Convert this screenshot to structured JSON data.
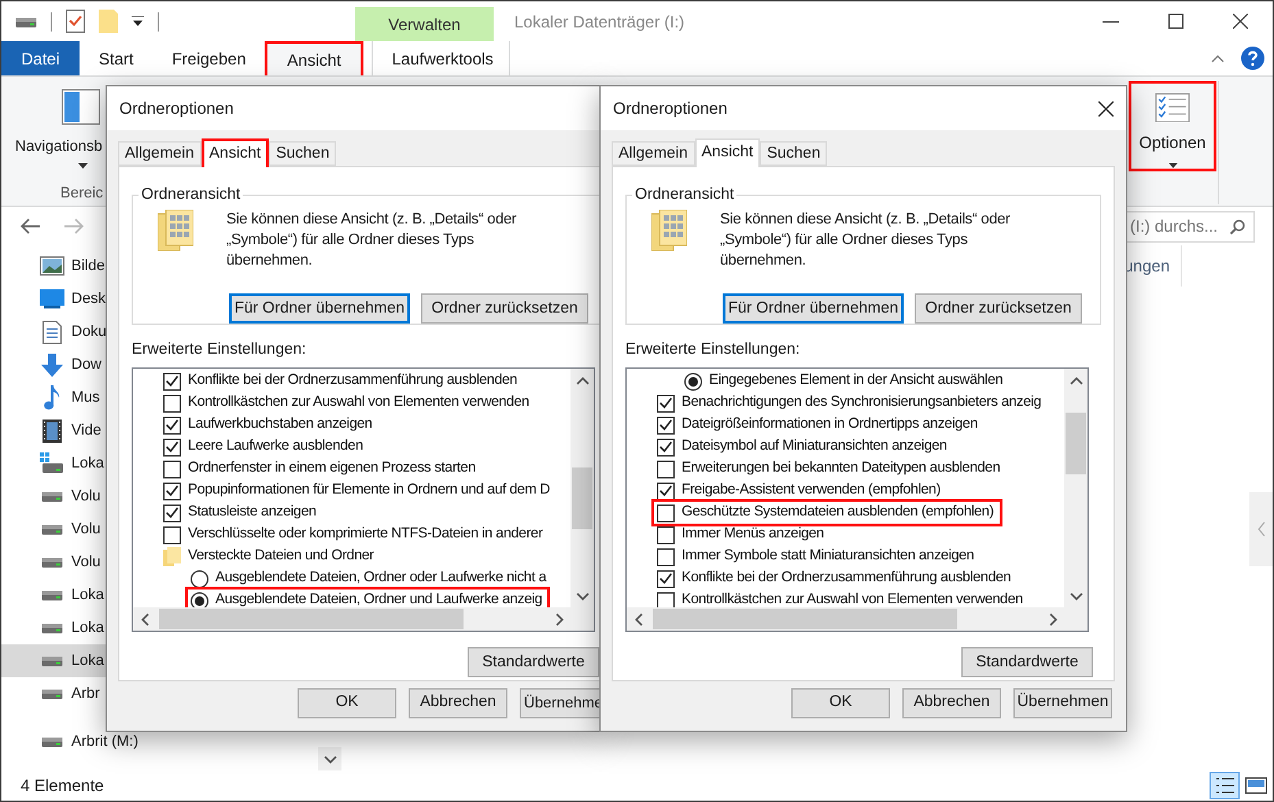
{
  "window": {
    "title": "Lokaler Datenträger (I:)",
    "context_tab": "Verwalten"
  },
  "ribbon_tabs": [
    {
      "label": "Datei",
      "kind": "file",
      "selected": false,
      "highlighted": false
    },
    {
      "label": "Start",
      "kind": "tab",
      "selected": false,
      "highlighted": false
    },
    {
      "label": "Freigeben",
      "kind": "tab",
      "selected": false,
      "highlighted": false
    },
    {
      "label": "Ansicht",
      "kind": "tab",
      "selected": true,
      "highlighted": true
    },
    {
      "label": "Laufwerktools",
      "kind": "tab",
      "selected": false,
      "highlighted": false
    }
  ],
  "ribbon": {
    "navigation_pane": {
      "label": "Navigationsb",
      "group": "Bereic"
    },
    "options": {
      "label": "Optionen",
      "highlighted": true
    }
  },
  "search": {
    "placeholder": "(I:) durchs..."
  },
  "column_header": "ungen",
  "nav_items": [
    {
      "label": "Bilde",
      "kind": "pictures",
      "selected": false
    },
    {
      "label": "Desk",
      "kind": "desktop",
      "selected": false
    },
    {
      "label": "Doku",
      "kind": "documents",
      "selected": false
    },
    {
      "label": "Dow",
      "kind": "downloads",
      "selected": false
    },
    {
      "label": "Mus",
      "kind": "music",
      "selected": false
    },
    {
      "label": "Vide",
      "kind": "videos",
      "selected": false
    },
    {
      "label": "Loka",
      "kind": "system-drive",
      "selected": false
    },
    {
      "label": "Volu",
      "kind": "drive",
      "selected": false
    },
    {
      "label": "Volu",
      "kind": "drive",
      "selected": false
    },
    {
      "label": "Volu",
      "kind": "drive",
      "selected": false
    },
    {
      "label": "Loka",
      "kind": "drive",
      "selected": false
    },
    {
      "label": "Loka",
      "kind": "drive",
      "selected": false
    },
    {
      "label": "Loka",
      "kind": "drive",
      "selected": true
    },
    {
      "label": "Arbr",
      "kind": "drive",
      "selected": false
    }
  ],
  "nav_bottom_items": [
    {
      "label": "Arbrit (M:)",
      "kind": "drive",
      "selected": false
    }
  ],
  "status_bar": {
    "text": "4 Elemente"
  },
  "dialogs": [
    {
      "title": "Ordneroptionen",
      "tabs": [
        {
          "label": "Allgemein",
          "selected": false,
          "highlighted": false
        },
        {
          "label": "Ansicht",
          "selected": true,
          "highlighted": true
        },
        {
          "label": "Suchen",
          "selected": false,
          "highlighted": false
        }
      ],
      "group_title": "Ordneransicht",
      "description": "Sie können diese Ansicht (z. B. „Details“ oder „Symbole“) für alle Ordner dieses Typs übernehmen.",
      "view_buttons": [
        {
          "label": "Für Ordner übernehmen",
          "default": true
        },
        {
          "label": "Ordner zurücksetzen",
          "default": false
        }
      ],
      "settings_label": "Erweiterte Einstellungen:",
      "settings": [
        {
          "kind": "checkbox",
          "label": "Konflikte bei der Ordnerzusammenführung ausblenden",
          "checked": true,
          "highlighted": false
        },
        {
          "kind": "checkbox",
          "label": "Kontrollkästchen zur Auswahl von Elementen verwenden",
          "checked": false,
          "highlighted": false
        },
        {
          "kind": "checkbox",
          "label": "Laufwerkbuchstaben anzeigen",
          "checked": true,
          "highlighted": false
        },
        {
          "kind": "checkbox",
          "label": "Leere Laufwerke ausblenden",
          "checked": true,
          "highlighted": false
        },
        {
          "kind": "checkbox",
          "label": "Ordnerfenster in einem eigenen Prozess starten",
          "checked": false,
          "highlighted": false
        },
        {
          "kind": "checkbox",
          "label": "Popupinformationen für Elemente in Ordnern und auf dem D",
          "checked": true,
          "highlighted": false
        },
        {
          "kind": "checkbox",
          "label": "Statusleiste anzeigen",
          "checked": true,
          "highlighted": false
        },
        {
          "kind": "checkbox",
          "label": "Verschlüsselte oder komprimierte NTFS-Dateien in anderer",
          "checked": false,
          "highlighted": false
        },
        {
          "kind": "folder",
          "label": "Versteckte Dateien und Ordner",
          "highlighted": false,
          "children": [
            {
              "kind": "radio",
              "label": "Ausgeblendete Dateien, Ordner oder Laufwerke nicht a",
              "selected": false,
              "highlighted": false
            },
            {
              "kind": "radio",
              "label": "Ausgeblendete Dateien, Ordner und Laufwerke anzeig",
              "selected": true,
              "highlighted": true
            }
          ]
        }
      ],
      "defaults_button": "Standardwerte",
      "footer_buttons": [
        "OK",
        "Abbrechen",
        "Übernehme"
      ]
    },
    {
      "title": "Ordneroptionen",
      "tabs": [
        {
          "label": "Allgemein",
          "selected": false,
          "highlighted": false
        },
        {
          "label": "Ansicht",
          "selected": true,
          "highlighted": false
        },
        {
          "label": "Suchen",
          "selected": false,
          "highlighted": false
        }
      ],
      "group_title": "Ordneransicht",
      "description": "Sie können diese Ansicht (z. B. „Details“ oder „Symbole“) für alle Ordner dieses Typs übernehmen.",
      "view_buttons": [
        {
          "label": "Für Ordner übernehmen",
          "default": true
        },
        {
          "label": "Ordner zurücksetzen",
          "default": false
        }
      ],
      "settings_label": "Erweiterte Einstellungen:",
      "settings": [
        {
          "kind": "radio",
          "label": "Eingegebenes Element in der Ansicht auswählen",
          "selected": true,
          "highlighted": false
        },
        {
          "kind": "checkbox",
          "label": "Benachrichtigungen des Synchronisierungsanbieters anzeig",
          "checked": true,
          "highlighted": false
        },
        {
          "kind": "checkbox",
          "label": "Dateigrößeinformationen in Ordnertipps anzeigen",
          "checked": true,
          "highlighted": false
        },
        {
          "kind": "checkbox",
          "label": "Dateisymbol auf Miniaturansichten anzeigen",
          "checked": true,
          "highlighted": false
        },
        {
          "kind": "checkbox",
          "label": "Erweiterungen bei bekannten Dateitypen ausblenden",
          "checked": false,
          "highlighted": false
        },
        {
          "kind": "checkbox",
          "label": "Freigabe-Assistent verwenden (empfohlen)",
          "checked": true,
          "highlighted": false
        },
        {
          "kind": "checkbox",
          "label": "Geschützte Systemdateien ausblenden (empfohlen)",
          "checked": false,
          "highlighted": true
        },
        {
          "kind": "checkbox",
          "label": "Immer Menüs anzeigen",
          "checked": false,
          "highlighted": false
        },
        {
          "kind": "checkbox",
          "label": "Immer Symbole statt Miniaturansichten anzeigen",
          "checked": false,
          "highlighted": false
        },
        {
          "kind": "checkbox",
          "label": "Konflikte bei der Ordnerzusammenführung ausblenden",
          "checked": true,
          "highlighted": false
        },
        {
          "kind": "checkbox",
          "label": "Kontrollkästchen zur Auswahl von Elementen verwenden",
          "checked": false,
          "highlighted": false
        }
      ],
      "defaults_button": "Standardwerte",
      "footer_buttons": [
        "OK",
        "Abbrechen",
        "Übernehmen"
      ]
    }
  ]
}
